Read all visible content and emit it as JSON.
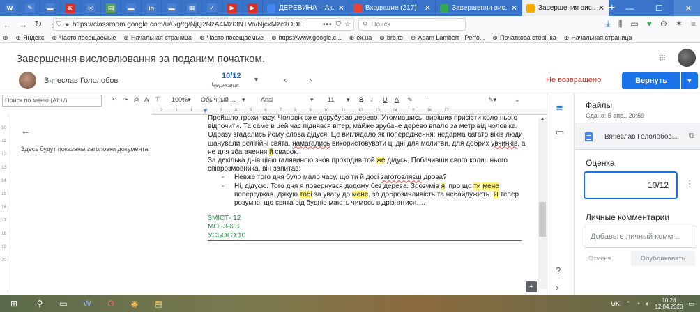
{
  "browser": {
    "tabs": [
      {
        "title": "ДЕРЕВИНА – Ак...",
        "favicon_color": "#4285f4",
        "active": false
      },
      {
        "title": "Входящие (217)",
        "favicon_color": "#ea4335",
        "active": false
      },
      {
        "title": "Завершення вис...",
        "favicon_color": "#34a853",
        "active": false
      },
      {
        "title": "Завершения вис...",
        "favicon_color": "#f9ab00",
        "active": true
      }
    ],
    "pinned": [
      {
        "glyph": "W",
        "color": "#4a7fd0"
      },
      {
        "glyph": "✎",
        "color": "#4a7fd0"
      },
      {
        "glyph": "▬",
        "color": "#4a7fd0"
      },
      {
        "glyph": "K",
        "color": "#d93025"
      },
      {
        "glyph": "◎",
        "color": "#4a7fd0"
      },
      {
        "glyph": "▤",
        "color": "#5a9e5a"
      },
      {
        "glyph": "▬",
        "color": "#4a7fd0"
      },
      {
        "glyph": "in",
        "color": "#4a7fd0"
      },
      {
        "glyph": "▬",
        "color": "#4a7fd0"
      },
      {
        "glyph": "▦",
        "color": "#4a7fd0"
      },
      {
        "glyph": "✓",
        "color": "#4a7fd0"
      },
      {
        "glyph": "▶",
        "color": "#d93025"
      },
      {
        "glyph": "▶",
        "color": "#d93025"
      }
    ],
    "new_tab": "+",
    "url": "https://classroom.google.com/u/0/g/tg/NjQ2NzA4MzI3NTVa/NjcxMzc1ODE2",
    "url_dots": "•••",
    "search_placeholder": "Поиск",
    "bookmarks": [
      "Яндекс",
      "Часто посещаемые",
      "Начальная страница",
      "Часто посещаемые",
      "https://www.google.c...",
      "ex.ua",
      "brb.to",
      "Adam Lambert - Perfo...",
      "Початкова сторінка",
      "Начальная страница"
    ]
  },
  "classroom": {
    "title": "Завершення висловлювання за поданим початком.",
    "student_name": "Вячеслав Гололобов",
    "grade_count": "10/12",
    "grade_status": "Черновик",
    "not_returned": "Не возвращено",
    "return_label": "Вернуть"
  },
  "docs_toolbar": {
    "menu_search": "Поиск по меню (Alt+/)",
    "zoom": "100%",
    "style": "Обычный ...",
    "font": "Arial",
    "size": "11",
    "bold": "B",
    "italic": "I",
    "underline": "U",
    "color": "A",
    "more": "···"
  },
  "outline": {
    "hint": "Здесь будут показаны заголовки документа."
  },
  "document": {
    "p1": "Пройшло трохи часу. Чоловік вже дорубував дерево. Утомившись, вирішив присісти коло нього відпочити. Та саме в цей час піднявся вітер, майже зрубане дерево впало за метр від чоловіка.",
    "p2a": "Одразу згадались йому слова дідуся! Це виглядало як попередження: недарма багато віків люди шанували релігійні свята, ",
    "p2b": "намагались",
    "p2c": " використовувати ці дні для молитви, для добрих ",
    "p2d": "увчинків",
    "p2e": ", а не для збагачення ",
    "p2f": "й",
    "p2g": " сварок.",
    "p3a": "За декілька днів цією галявиною знов проходив той ",
    "p3b": "же",
    "p3c": " дідусь. Побачивши свого колишнього співрозмовника, він запитав:",
    "b1a": "Невже того дня було мало часу, що ти й досі ",
    "b1b": "заготовляєш",
    "b1c": " дрова?",
    "b2a": "Ні, дідусю. Того дня я повернувся додому без дерева. Зрозумів ",
    "b2b": "я",
    "b2c": ", про що ",
    "b2d": "ти",
    "b2e": "мене",
    "b2f": " попереджав. Дякую ",
    "b2g": "тобі",
    "b2h": " за увагу до ",
    "b2i": "мене",
    "b2j": ", за доброзичливість та небайдужість. ",
    "b2k": "Я",
    "b2l": " тепер розумію, що свята від буднів  мають чимось відрізнятися….",
    "score1": "ЗМІСТ- 12",
    "score2": "МО -3-6:8",
    "score3": "УСЬОГО:10"
  },
  "panel": {
    "files_title": "Файлы",
    "files_date": "Сдано: 5 апр., 20:59",
    "file_name": "Вячеслав Гололобов...",
    "grade_title": "Оценка",
    "grade_value": "10/12",
    "comments_title": "Личные комментарии",
    "comment_placeholder": "Добавьте личный комм...",
    "cancel": "Отмена",
    "publish": "Опубликовать"
  },
  "taskbar": {
    "lang": "UK",
    "time": "10:28",
    "date": "12.04.2020"
  },
  "ruler": {
    "top_numbers": [
      "2",
      "1",
      "1",
      "2",
      "3",
      "4",
      "5",
      "6",
      "7",
      "8",
      "9",
      "10",
      "11",
      "12",
      "13",
      "14",
      "15",
      "16",
      "17"
    ],
    "left_numbers": [
      "10",
      "11",
      "12",
      "13",
      "14",
      "15",
      "16",
      "17",
      "18",
      "19",
      "20"
    ]
  }
}
